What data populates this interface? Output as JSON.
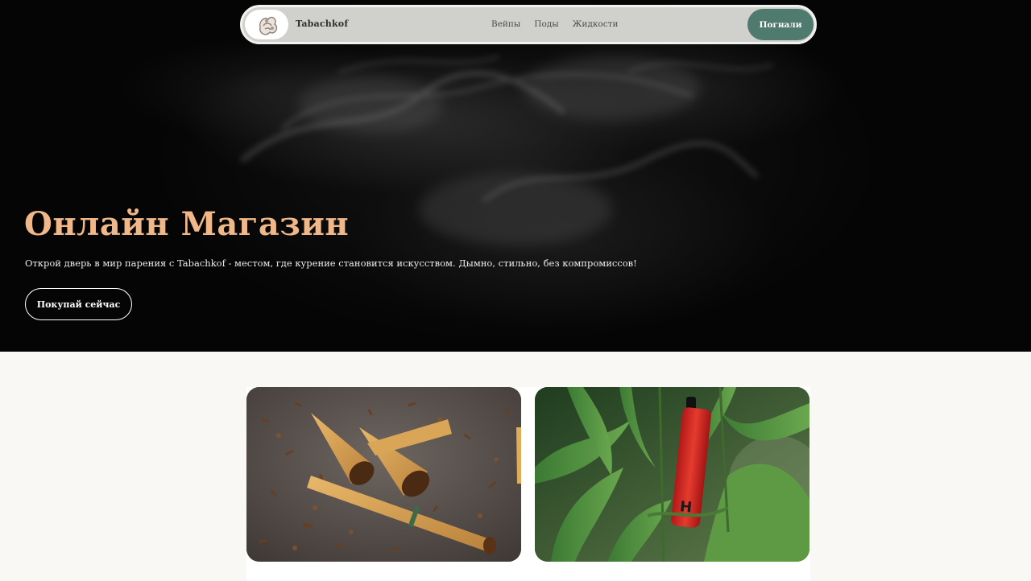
{
  "header": {
    "logo_icon": "tabachkof-logo",
    "brand": "Tabachkof",
    "nav": [
      {
        "label": "Вейпы"
      },
      {
        "label": "Поды"
      },
      {
        "label": "Жидкости"
      }
    ],
    "cta_label": "Погнали"
  },
  "hero": {
    "title": "Онлайн Магазин",
    "subtitle": "Открой дверь в мир парения с Tabachkof - местом, где курение становится искусством. Дымно, стильно, без компромиссов!",
    "button_label": "Покупай сейчас",
    "title_color": "#f0b889"
  },
  "cards": [
    {
      "image": "tobacco-leaf-cones-photo"
    },
    {
      "image": "red-vape-in-green-leaves-photo"
    }
  ],
  "colors": {
    "accent": "#4f7a6e",
    "hero_bg": "#050505",
    "page_bg": "#f9f8f5"
  }
}
